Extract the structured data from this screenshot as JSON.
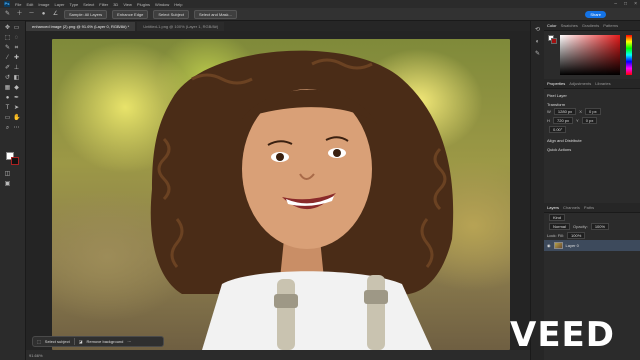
{
  "menubar": {
    "logo": "Ps",
    "items": [
      "File",
      "Edit",
      "Image",
      "Layer",
      "Type",
      "Select",
      "Filter",
      "3D",
      "View",
      "Plugins",
      "Window",
      "Help"
    ],
    "controls": [
      "–",
      "□",
      "×"
    ]
  },
  "options": {
    "b1": "Sample: All Layers",
    "b2": "Enhance Edge",
    "b3": "Select Subject",
    "b4": "Select and Mask...",
    "share": "Share"
  },
  "tabs": [
    "enhanced image (2).png @ 91.6% (Layer 0, RGB/8#) *",
    "Untitled-1.png @ 100% (Layer 1, RGB/8#)"
  ],
  "status": {
    "text": "91.66%"
  },
  "subject": {
    "select": "Select subject",
    "remove": "Remove background"
  },
  "panel": {
    "tabs": [
      "Color",
      "Swatches",
      "Gradients",
      "Patterns"
    ],
    "props_tabs": [
      "Properties",
      "Adjustments",
      "Libraries"
    ],
    "props": {
      "type": "Pixel Layer",
      "transform": "Transform",
      "w": "1280 px",
      "x": "0 px",
      "h": "720 px",
      "y": "0 px",
      "angle": "0.00°",
      "align": "Align and Distribute",
      "quick": "Quick Actions"
    },
    "layers": {
      "tabs": [
        "Layers",
        "Channels",
        "Paths"
      ],
      "kind": "Kind",
      "mode": "Normal",
      "opacity_label": "Opacity:",
      "opacity": "100%",
      "fill_label": "Fill:",
      "fill": "100%",
      "lock": "Lock:",
      "row": "Layer 0"
    }
  },
  "watermark": "VEED"
}
